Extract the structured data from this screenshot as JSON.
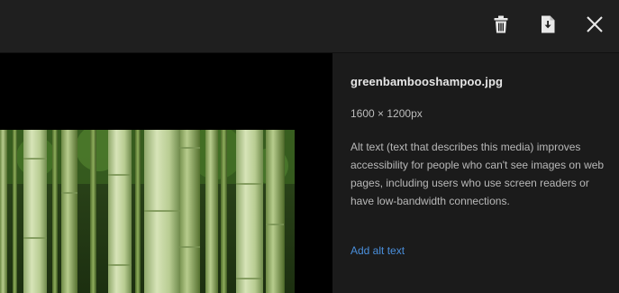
{
  "toolbar": {
    "delete_icon": "trash-icon",
    "download_icon": "download-icon",
    "close_icon": "close-icon"
  },
  "media": {
    "description_icon": "bamboo-image"
  },
  "details": {
    "file_name": "greenbambooshampoo.jpg",
    "dimensions": "1600 × 1200px",
    "alt_text_description": "Alt text (text that describes this media) improves accessibility for people who can't see images on web pages, including users who use screen readers or have low-bandwidth connections.",
    "add_alt_text_link": "Add alt text"
  },
  "colors": {
    "background": "#1b1b1b",
    "media_background": "#000000",
    "link": "#4a8fdc"
  }
}
